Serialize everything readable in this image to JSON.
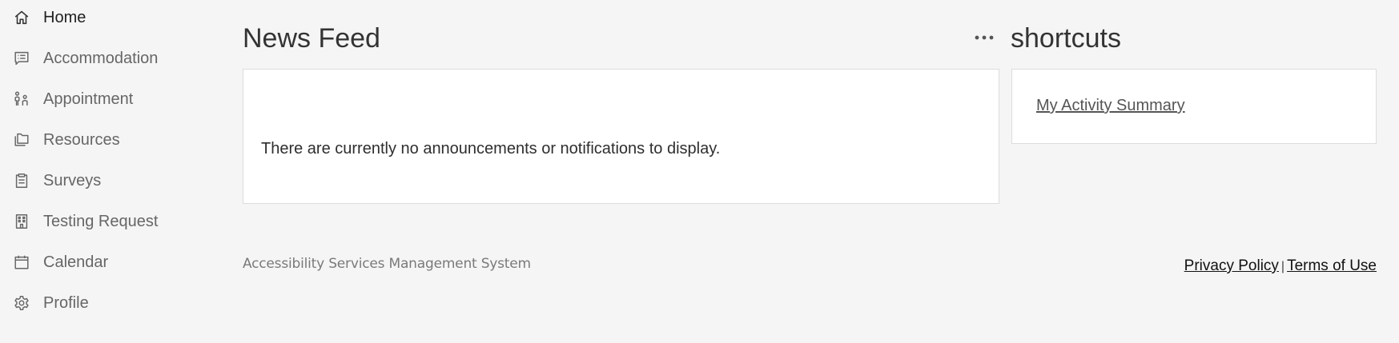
{
  "sidebar": {
    "items": [
      {
        "label": "Home",
        "icon": "home-icon",
        "active": true
      },
      {
        "label": "Accommodation",
        "icon": "list-chat-icon",
        "active": false
      },
      {
        "label": "Appointment",
        "icon": "people-icon",
        "active": false
      },
      {
        "label": "Resources",
        "icon": "folders-icon",
        "active": false
      },
      {
        "label": "Surveys",
        "icon": "clipboard-icon",
        "active": false
      },
      {
        "label": "Testing Request",
        "icon": "building-icon",
        "active": false
      },
      {
        "label": "Calendar",
        "icon": "calendar-icon",
        "active": false
      },
      {
        "label": "Profile",
        "icon": "gear-icon",
        "active": false
      }
    ]
  },
  "news_feed": {
    "title": "News Feed",
    "more_icon": "more-horizontal-icon",
    "empty_message": "There are currently no announcements or notifications to display."
  },
  "shortcuts": {
    "title": "shortcuts",
    "links": [
      {
        "label": "My Activity Summary"
      }
    ]
  },
  "footer": {
    "brand": "Accessibility Services Management System",
    "privacy_label": "Privacy Policy",
    "separator": "|",
    "terms_label": "Terms of Use"
  },
  "colors": {
    "background": "#f5f5f5",
    "card": "#ffffff",
    "text_muted": "#666666",
    "text_active": "#1f1f1f"
  }
}
